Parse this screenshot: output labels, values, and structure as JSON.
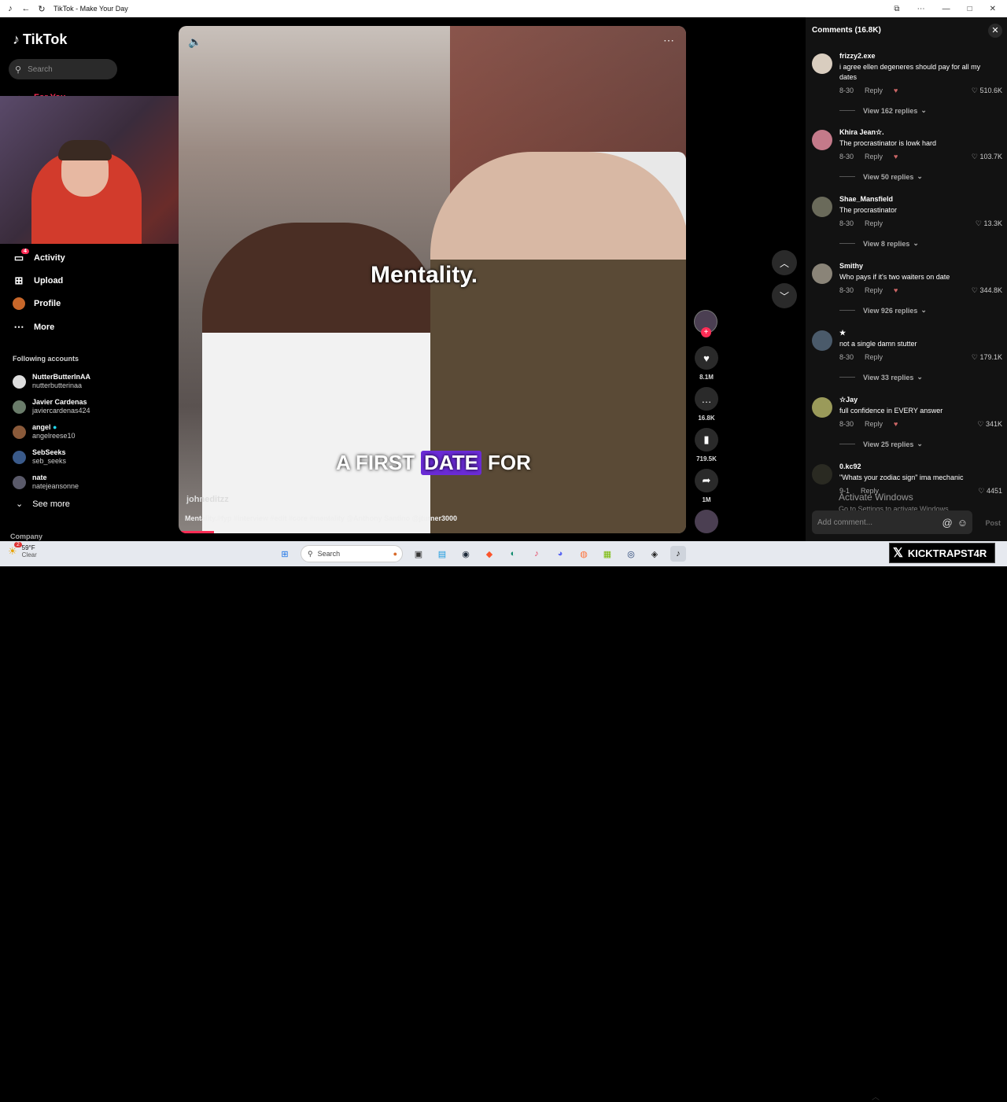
{
  "window": {
    "title": "TikTok - Make Your Day"
  },
  "sidebar": {
    "logo": "TikTok",
    "search_placeholder": "Search",
    "partial_item": "For You",
    "nav": [
      {
        "label": "Activity",
        "icon": "message-icon",
        "badge": "4"
      },
      {
        "label": "Upload",
        "icon": "plus-square-icon"
      },
      {
        "label": "Profile",
        "icon": "avatar"
      },
      {
        "label": "More",
        "icon": "more-dots-icon"
      }
    ],
    "following_title": "Following accounts",
    "accounts": [
      {
        "name": "NutterButterInAA",
        "username": "nutterbutterinaa"
      },
      {
        "name": "Javier Cardenas",
        "username": "javiercardenas424"
      },
      {
        "name": "angel",
        "username": "angelreese10",
        "verified": true
      },
      {
        "name": "SebSeeks",
        "username": "seb_seeks"
      },
      {
        "name": "nate",
        "username": "natejeansonne"
      }
    ],
    "see_more": "See more",
    "company": "Company"
  },
  "video": {
    "caption_top": "Mentality.",
    "caption_bottom": [
      "A FIRST",
      "DATE",
      "FOR"
    ],
    "author": "johneditzz",
    "description": "Mentality.#fyp #interview #edit #core #mentality @Anthony Santino @jturner3000"
  },
  "actions": {
    "likes": "8.1M",
    "comments": "16.8K",
    "saves": "719.5K",
    "shares": "1M"
  },
  "comments_panel": {
    "title": "Comments (16.8K)",
    "items": [
      {
        "user": "frizzy2.exe",
        "text": "i agree ellen degeneres should pay for all my dates",
        "date": "8-30",
        "reply": "Reply",
        "likes": "510.6K",
        "replies": "View 162 replies"
      },
      {
        "user": "Khira Jean☆.",
        "text": "The procrastinator is lowk hard",
        "date": "8-30",
        "reply": "Reply",
        "likes": "103.7K",
        "replies": "View 50 replies"
      },
      {
        "user": "Shae_Mansfield",
        "text": "The procrastinator",
        "date": "8-30",
        "reply": "Reply",
        "likes": "13.3K",
        "replies": "View 8 replies"
      },
      {
        "user": "Smithy",
        "text": "Who pays if it's two waiters on date",
        "date": "8-30",
        "reply": "Reply",
        "likes": "344.8K",
        "replies": "View 926 replies"
      },
      {
        "user": "★",
        "text": "not a single damn stutter",
        "date": "8-30",
        "reply": "Reply",
        "likes": "179.1K",
        "replies": "View 33 replies"
      },
      {
        "user": "☆Jay",
        "text": "full confidence in EVERY answer",
        "date": "8-30",
        "reply": "Reply",
        "likes": "341K",
        "replies": "View 25 replies"
      },
      {
        "user": "0.kc92",
        "text": "\"Whats your zodiac sign\" ima mechanic",
        "date": "9-1",
        "reply": "Reply",
        "likes": "4451",
        "replies": ""
      }
    ],
    "add_placeholder": "Add comment...",
    "post": "Post",
    "activate_title": "Activate Windows",
    "activate_sub": "Go to Settings to activate Windows."
  },
  "taskbar": {
    "weather_badge": "2",
    "temperature": "59°F",
    "condition": "Clear",
    "search": "Search",
    "brand": "KICKTRAPST4R"
  }
}
